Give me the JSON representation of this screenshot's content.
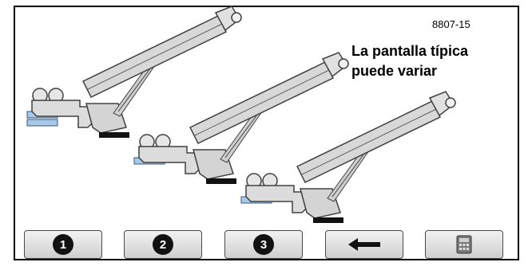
{
  "figure_code": "8807-15",
  "caption": {
    "line1": "La pantalla típica",
    "line2": "puede variar"
  },
  "buttons": [
    {
      "label": "1",
      "icon": "number-one"
    },
    {
      "label": "2",
      "icon": "number-two"
    },
    {
      "label": "3",
      "icon": "number-three"
    },
    {
      "label": "",
      "icon": "arrow-left-icon"
    },
    {
      "label": "",
      "icon": "calculator-icon"
    }
  ],
  "colors": {
    "machine_fill": "#dcdcdc",
    "machine_stroke": "#404040",
    "pad_blue": "#a8c8e8",
    "foot_black": "#111111"
  }
}
